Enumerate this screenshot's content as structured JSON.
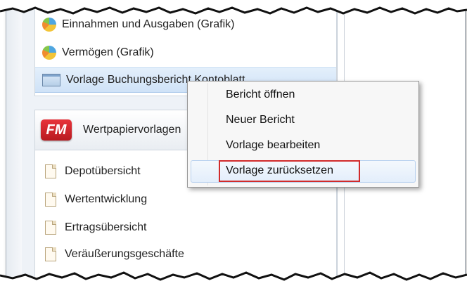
{
  "group1": {
    "items": [
      {
        "label": "Einnahmen und Ausgaben (Grafik)",
        "icon": "pie-chart-icon"
      },
      {
        "label": "Vermögen (Grafik)",
        "icon": "pie-chart-icon"
      },
      {
        "label": "Vorlage Buchungsbericht Kontoblatt",
        "icon": "window-icon",
        "selected": true
      }
    ]
  },
  "group2": {
    "logo_text": "FM",
    "title": "Wertpapiervorlagen",
    "items": [
      {
        "label": "Depotübersicht",
        "icon": "document-icon"
      },
      {
        "label": "Wertentwicklung",
        "icon": "document-icon"
      },
      {
        "label": "Ertragsübersicht",
        "icon": "document-icon"
      },
      {
        "label": "Veräußerungsgeschäfte",
        "icon": "document-icon"
      }
    ]
  },
  "context_menu": {
    "items": [
      {
        "label": "Bericht öffnen"
      },
      {
        "label": "Neuer Bericht"
      },
      {
        "label": "Vorlage bearbeiten"
      },
      {
        "label": "Vorlage zurücksetzen",
        "hovered": true,
        "highlighted": true
      }
    ]
  },
  "colors": {
    "highlight_box": "#d12b2b",
    "logo_red": "#c8232a",
    "selection_blue": "#cfe2f7"
  }
}
